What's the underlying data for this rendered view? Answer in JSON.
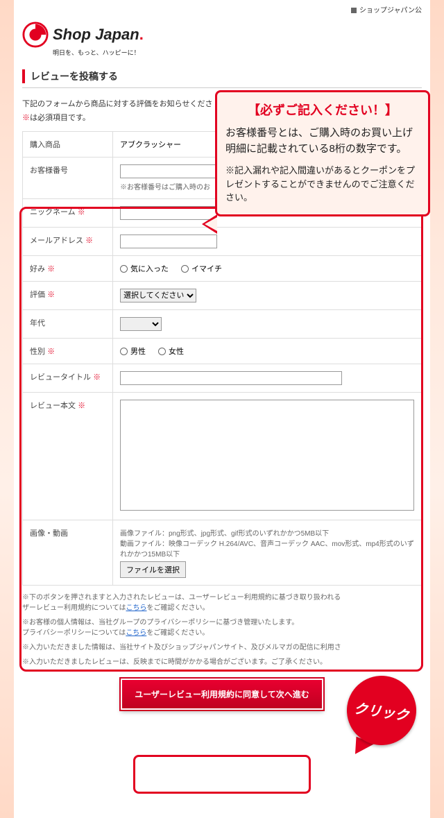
{
  "topbar": {
    "link": "ショップジャパン公"
  },
  "logo": {
    "brand": "Shop Japan",
    "tagline": "明日を、もっと、ハッピーに！"
  },
  "section": {
    "title": "レビューを投稿する"
  },
  "intro": "下記のフォームから商品に対する評価をお知らせくださ",
  "required_note_prefix": "※",
  "required_note": "は必須項目です。",
  "fields": {
    "product": {
      "label": "購入商品",
      "value": "アブクラッシャー"
    },
    "customer_no": {
      "label": "お客様番号",
      "help": "※お客様番号はご購入時のお"
    },
    "nickname": {
      "label": "ニックネーム"
    },
    "email": {
      "label": "メールアドレス"
    },
    "preference": {
      "label": "好み",
      "opt1": "気に入った",
      "opt2": "イマイチ"
    },
    "rating": {
      "label": "評価",
      "placeholder": "選択してください"
    },
    "age": {
      "label": "年代"
    },
    "gender": {
      "label": "性別",
      "opt1": "男性",
      "opt2": "女性"
    },
    "review_title": {
      "label": "レビュータイトル"
    },
    "review_body": {
      "label": "レビュー本文"
    },
    "media": {
      "label": "画像・動画",
      "help1": "画像ファイル：png形式、jpg形式、gif形式のいずれかかつ5MB以下",
      "help2": "動画ファイル：映像コーデック H.264/AVC、音声コーデック AAC、mov形式、mp4形式のいずれかかつ15MB以下",
      "button": "ファイルを選択"
    }
  },
  "req_mark": "※",
  "notes": {
    "n1a": "※下のボタンを押されますと入力されたレビューは、ユーザーレビュー利用規約に基づき取り扱われる",
    "n1b": "ザーレビュー利用規約については",
    "n1link": "こちら",
    "n1c": "をご確認ください。",
    "n2a": "※お客様の個人情報は、当社グループのプライバシーポリシーに基づき管理いたします。",
    "n2b": "プライバシーポリシーについては",
    "n2link": "こちら",
    "n2c": "をご確認ください。",
    "n3": "※入力いただきました情報は、当社サイト及びショップジャパンサイト、及びメルマガの配信に利用さ",
    "n4": "※入力いただきましたレビューは、反映までに時間がかかる場合がございます。ご了承ください。"
  },
  "submit": {
    "label": "ユーザーレビュー利用規約に同意して次へ進む"
  },
  "callout": {
    "title": "【必ずご記入ください！】",
    "body": "お客様番号とは、ご購入時のお買い上げ明細に記載されている8桁の数字です。",
    "note": "※記入漏れや記入間違いがあるとクーポンをプレゼントすることができませんのでご注意ください。"
  },
  "click_bubble": "クリック"
}
